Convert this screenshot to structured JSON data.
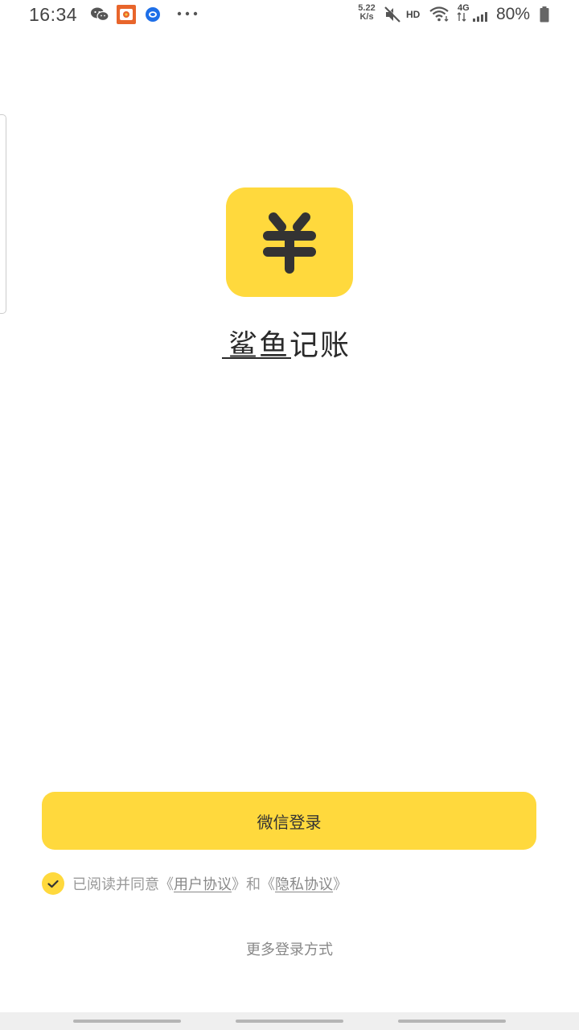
{
  "status_bar": {
    "time": "16:34",
    "net_speed_value": "5.22",
    "net_speed_unit": "K/s",
    "hd_label": "HD",
    "network_label": "4G",
    "battery": "80%",
    "icons": [
      "wechat-icon",
      "app-notification-icon",
      "message-icon",
      "more-dots-icon",
      "mute-icon",
      "wifi-icon",
      "signal-icon",
      "battery-icon"
    ]
  },
  "app": {
    "logo_icon": "yuan-logo-icon",
    "name": "鲨鱼记账",
    "accent_color": "#FFD93D"
  },
  "login": {
    "wechat_button_label": "微信登录",
    "agreement_prefix": "已阅读并同意《",
    "user_agreement_link": "用户协议",
    "agreement_middle": "》和《",
    "privacy_agreement_link": "隐私协议",
    "agreement_suffix": "》",
    "more_login_label": "更多登录方式"
  }
}
